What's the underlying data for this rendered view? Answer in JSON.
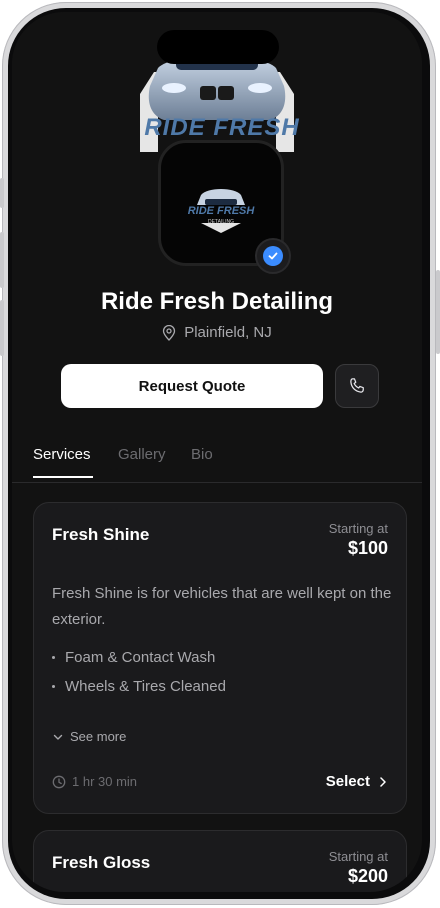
{
  "business": {
    "name": "Ride Fresh Detailing",
    "location": "Plainfield, NJ",
    "banner_brand": "RIDE FRESH",
    "logo_brand": "RIDE FRESH",
    "logo_tagline": "DETAILING"
  },
  "actions": {
    "request_quote": "Request Quote"
  },
  "tabs": [
    {
      "label": "Services",
      "active": true
    },
    {
      "label": "Gallery",
      "active": false
    },
    {
      "label": "Bio",
      "active": false
    }
  ],
  "services": [
    {
      "name": "Fresh Shine",
      "starting_label": "Starting at",
      "price": "$100",
      "description": "Fresh Shine is for vehicles that are well kept on the exterior.",
      "features": [
        "Foam & Contact Wash",
        "Wheels & Tires Cleaned"
      ],
      "see_more": "See more",
      "duration": "1 hr 30 min",
      "select_label": "Select"
    },
    {
      "name": "Fresh Gloss",
      "starting_label": "Starting at",
      "price": "$200"
    }
  ],
  "colors": {
    "background": "#121212",
    "card": "#1a1a1c",
    "accent_verified": "#3b8cff",
    "text_primary": "#ffffff",
    "text_secondary": "#a9a9ad"
  }
}
